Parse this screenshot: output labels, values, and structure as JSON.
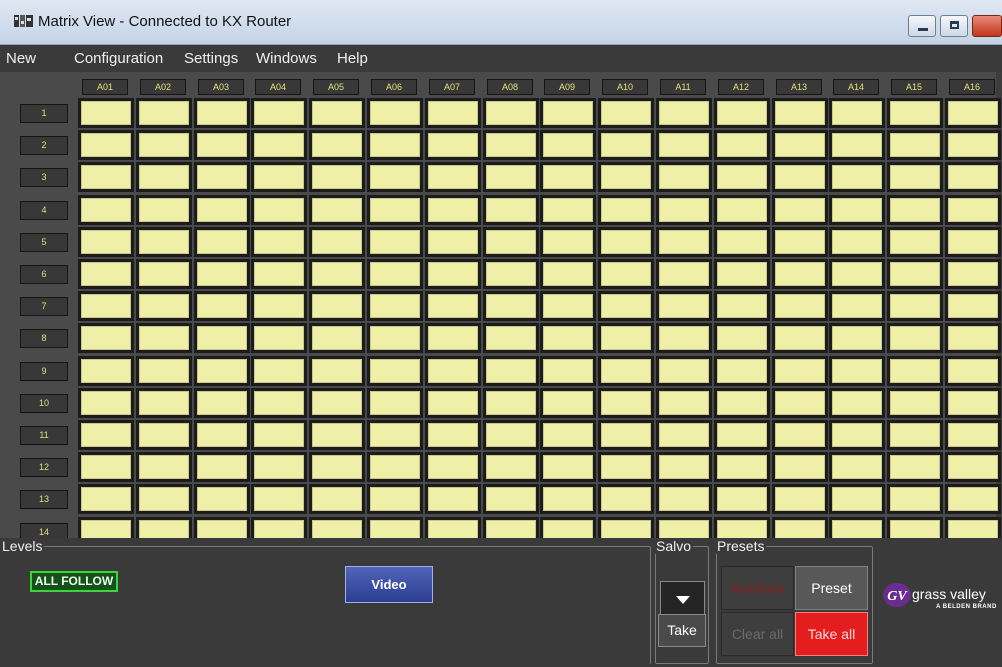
{
  "window": {
    "title": "Matrix View - Connected to KX Router",
    "controls": [
      "minimize-icon",
      "maximize-icon",
      "close-icon"
    ]
  },
  "menu": [
    "New",
    "Configuration",
    "Settings",
    "Windows",
    "Help"
  ],
  "matrix": {
    "columns": [
      "A01",
      "A02",
      "A03",
      "A04",
      "A05",
      "A06",
      "A07",
      "A08",
      "A09",
      "A10",
      "A11",
      "A12",
      "A13",
      "A14",
      "A15",
      "A16"
    ],
    "rows": [
      "1",
      "2",
      "3",
      "4",
      "5",
      "6",
      "7",
      "8",
      "9",
      "10",
      "11",
      "12",
      "13",
      "14"
    ],
    "cell_color": "#efefa8"
  },
  "levels": {
    "title": "Levels",
    "all_follow": "ALL FOLLOW",
    "video": "Video"
  },
  "salvo": {
    "title": "Salvo",
    "take": "Take",
    "dropdown_icon": "chevron-down-icon"
  },
  "presets": {
    "title": "Presets",
    "autolock": "Autolock",
    "preset": "Preset",
    "clear_all": "Clear all",
    "take_all": "Take all"
  },
  "logo": {
    "text": "grass valley",
    "subtext": "A BELDEN BRAND",
    "brand_color": "#6a2c91"
  }
}
